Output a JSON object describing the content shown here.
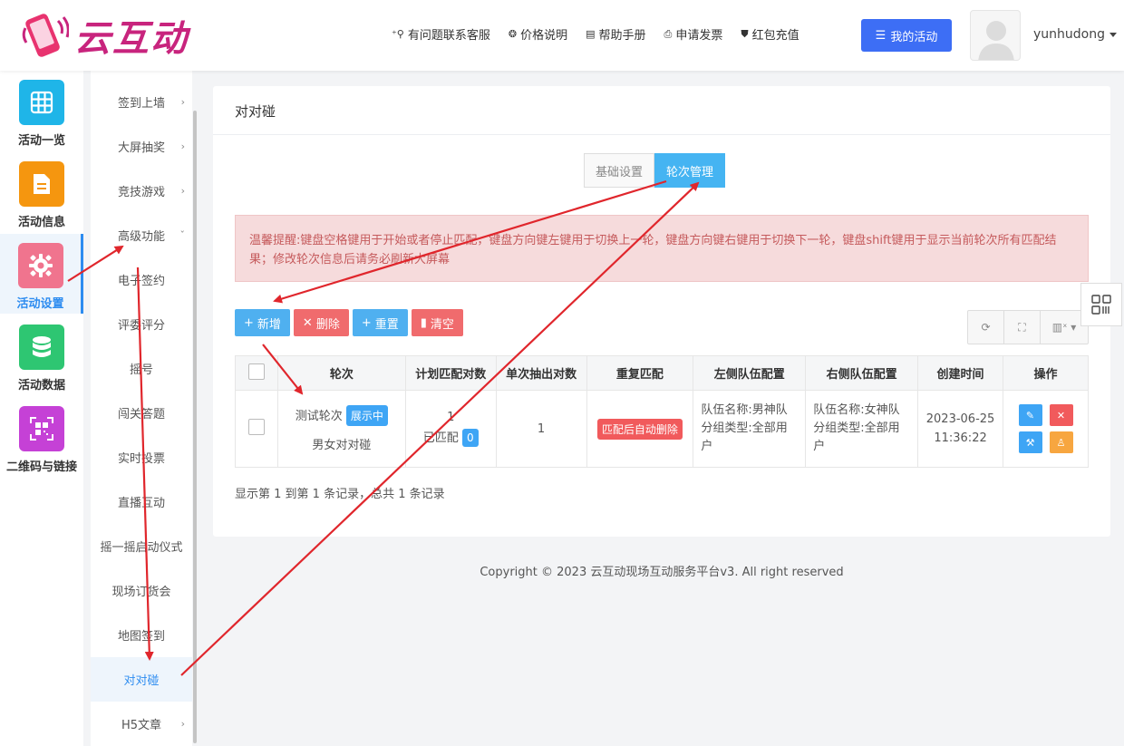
{
  "brand": {
    "name": "云互动"
  },
  "header": {
    "nav": [
      {
        "icon": "contact-icon",
        "label": "有问题联系客服"
      },
      {
        "icon": "price-icon",
        "label": "价格说明"
      },
      {
        "icon": "manual-icon",
        "label": "帮助手册"
      },
      {
        "icon": "printer-icon",
        "label": "申请发票"
      },
      {
        "icon": "shield-icon",
        "label": "红包充值"
      }
    ],
    "my_activity": "我的活动",
    "username": "yunhudong"
  },
  "rail": [
    {
      "label": "活动一览",
      "color": "#1fb5e8",
      "icon": "grid-icon"
    },
    {
      "label": "活动信息",
      "color": "#f5960f",
      "icon": "document-icon"
    },
    {
      "label": "活动设置",
      "color": "#f0748e",
      "icon": "gear-icon",
      "active": true
    },
    {
      "label": "活动数据",
      "color": "#2ec672",
      "icon": "database-icon"
    },
    {
      "label": "二维码与链接",
      "color": "#c541d6",
      "icon": "qrcode-icon"
    }
  ],
  "submenu": [
    {
      "label": "签到上墙",
      "arrow": "›"
    },
    {
      "label": "大屏抽奖",
      "arrow": "›"
    },
    {
      "label": "竞技游戏",
      "arrow": "›"
    },
    {
      "label": "高级功能",
      "arrow": "ˇ"
    },
    {
      "label": "电子签约",
      "arrow": ""
    },
    {
      "label": "评委评分",
      "arrow": ""
    },
    {
      "label": "摇号",
      "arrow": ""
    },
    {
      "label": "闯关答题",
      "arrow": ""
    },
    {
      "label": "实时投票",
      "arrow": ""
    },
    {
      "label": "直播互动",
      "arrow": ""
    },
    {
      "label": "摇一摇启动仪式",
      "arrow": ""
    },
    {
      "label": "现场订货会",
      "arrow": ""
    },
    {
      "label": "地图签到",
      "arrow": ""
    },
    {
      "label": "对对碰",
      "arrow": "",
      "active": true
    },
    {
      "label": "H5文章",
      "arrow": "›"
    }
  ],
  "panel": {
    "title": "对对碰",
    "tabs": [
      "基础设置",
      "轮次管理"
    ],
    "active_tab": "轮次管理",
    "warning": "温馨提醒:键盘空格键用于开始或者停止匹配，键盘方向键左键用于切换上一轮，键盘方向键右键用于切换下一轮，键盘shift键用于显示当前轮次所有匹配结果；修改轮次信息后请务必刷新大屏幕",
    "toolbar": {
      "add": "新增",
      "delete": "删除",
      "reset": "重置",
      "clear": "清空"
    },
    "columns": [
      "轮次",
      "计划匹配对数",
      "单次抽出对数",
      "重复匹配",
      "左侧队伍配置",
      "右侧队伍配置",
      "创建时间",
      "操作"
    ],
    "rows": [
      {
        "round_name": "测试轮次",
        "round_status": "展示中",
        "round_sub": "男女对对碰",
        "planned": "1",
        "matched_label": "已匹配",
        "matched": "0",
        "per_draw": "1",
        "repeat": "匹配后自动删除",
        "left_team": "队伍名称:男神队 分组类型:全部用户",
        "right_team": "队伍名称:女神队 分组类型:全部用户",
        "created": "2023-06-25 11:36:22"
      }
    ],
    "page_info": "显示第 1 到第 1 条记录，总共 1 条记录"
  },
  "footer": {
    "copyright": "Copyright © 2023 云互动现场互动服务平台v3. All right reserved"
  }
}
